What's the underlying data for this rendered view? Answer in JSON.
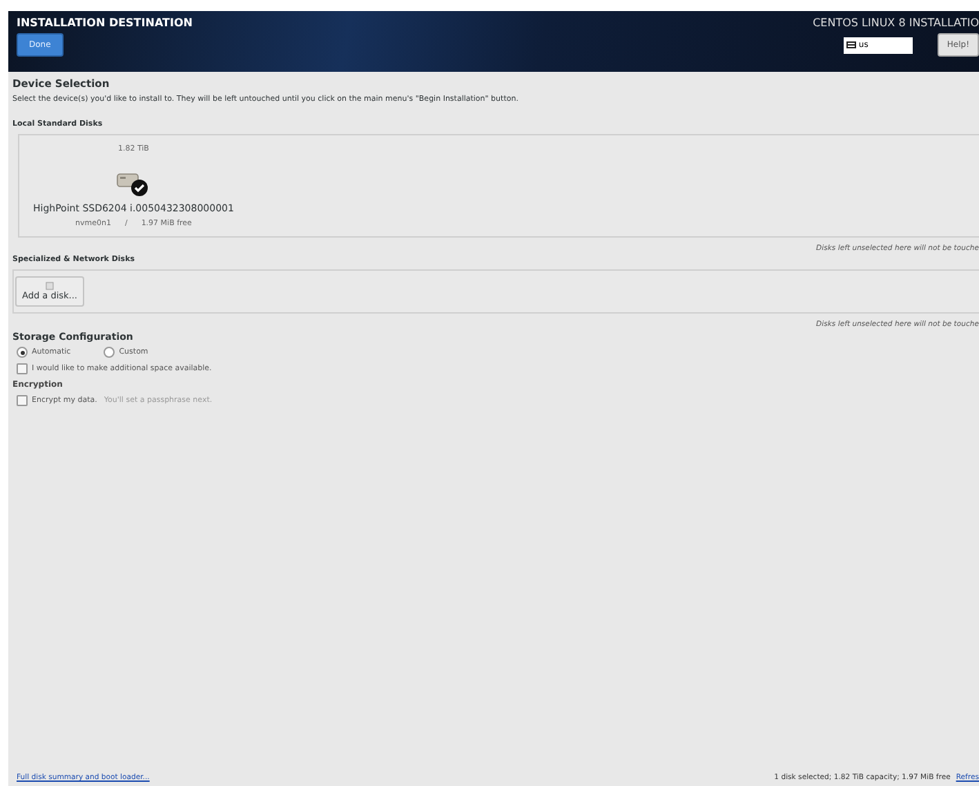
{
  "header": {
    "title": "INSTALLATION DESTINATION",
    "done_button": "Done",
    "product": "CENTOS LINUX 8 INSTALLATIO",
    "keyboard": "us",
    "help_button": "Help!"
  },
  "device_selection": {
    "heading": "Device Selection",
    "intro": "Select the device(s) you'd like to install to.  They will be left untouched until you click on the main menu's \"Begin Installation\" button."
  },
  "local_disks": {
    "heading": "Local Standard Disks",
    "disks": [
      {
        "size": "1.82 TiB",
        "name": "HighPoint SSD6204 i.0050432308000001",
        "device": "nvme0n1",
        "separator": "/",
        "free": "1.97 MiB free",
        "selected": true
      }
    ],
    "note": "Disks left unselected here will not be touche"
  },
  "network_disks": {
    "heading": "Specialized & Network Disks",
    "add_button": "Add a disk...",
    "note": "Disks left unselected here will not be touche"
  },
  "storage": {
    "heading": "Storage Configuration",
    "options": [
      {
        "label": "Automatic",
        "selected": true
      },
      {
        "label": "Custom",
        "selected": false
      }
    ],
    "reclaim": {
      "label": "I would like to make additional space available.",
      "checked": false
    }
  },
  "encryption": {
    "heading": "Encryption",
    "encrypt": {
      "label": "Encrypt my data.",
      "hint": "You'll set a passphrase next.",
      "checked": false
    }
  },
  "footer": {
    "summary_link": "Full disk summary and boot loader...",
    "status": "1 disk selected; 1.82 TiB capacity; 1.97 MiB free",
    "refresh_link": "Refres"
  }
}
